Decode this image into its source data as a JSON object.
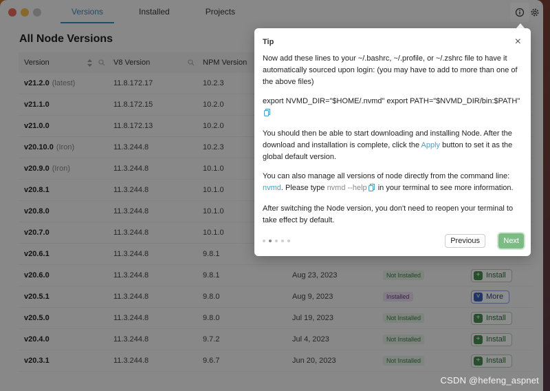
{
  "tabs": [
    "Versions",
    "Installed",
    "Projects"
  ],
  "heading": "All Node Versions",
  "columns": {
    "version": "Version",
    "v8": "V8 Version",
    "npm": "NPM Version"
  },
  "rows": [
    {
      "version": "v21.2.0",
      "tag": "(latest)",
      "v8": "11.8.172.17",
      "npm": "10.2.3",
      "date": "",
      "status": "",
      "action": ""
    },
    {
      "version": "v21.1.0",
      "tag": "",
      "v8": "11.8.172.15",
      "npm": "10.2.0",
      "date": "",
      "status": "",
      "action": ""
    },
    {
      "version": "v21.0.0",
      "tag": "",
      "v8": "11.8.172.13",
      "npm": "10.2.0",
      "date": "",
      "status": "",
      "action": ""
    },
    {
      "version": "v20.10.0",
      "tag": "(Iron)",
      "v8": "11.3.244.8",
      "npm": "10.2.3",
      "date": "",
      "status": "",
      "action": ""
    },
    {
      "version": "v20.9.0",
      "tag": "(Iron)",
      "v8": "11.3.244.8",
      "npm": "10.1.0",
      "date": "",
      "status": "",
      "action": ""
    },
    {
      "version": "v20.8.1",
      "tag": "",
      "v8": "11.3.244.8",
      "npm": "10.1.0",
      "date": "",
      "status": "",
      "action": ""
    },
    {
      "version": "v20.8.0",
      "tag": "",
      "v8": "11.3.244.8",
      "npm": "10.1.0",
      "date": "",
      "status": "",
      "action": ""
    },
    {
      "version": "v20.7.0",
      "tag": "",
      "v8": "11.3.244.8",
      "npm": "10.1.0",
      "date": "",
      "status": "",
      "action": ""
    },
    {
      "version": "v20.6.1",
      "tag": "",
      "v8": "11.3.244.8",
      "npm": "9.8.1",
      "date": "",
      "status": "",
      "action": ""
    },
    {
      "version": "v20.6.0",
      "tag": "",
      "v8": "11.3.244.8",
      "npm": "9.8.1",
      "date": "Aug 23, 2023",
      "status": "Not Installed",
      "action": "Install"
    },
    {
      "version": "v20.5.1",
      "tag": "",
      "v8": "11.3.244.8",
      "npm": "9.8.0",
      "date": "Aug 9, 2023",
      "status": "Installed",
      "action": "More"
    },
    {
      "version": "v20.5.0",
      "tag": "",
      "v8": "11.3.244.8",
      "npm": "9.8.0",
      "date": "Jul 19, 2023",
      "status": "Not Installed",
      "action": "Install"
    },
    {
      "version": "v20.4.0",
      "tag": "",
      "v8": "11.3.244.8",
      "npm": "9.7.2",
      "date": "Jul 4, 2023",
      "status": "Not Installed",
      "action": "Install"
    },
    {
      "version": "v20.3.1",
      "tag": "",
      "v8": "11.3.244.8",
      "npm": "9.6.7",
      "date": "Jun 20, 2023",
      "status": "Not Installed",
      "action": "Install"
    }
  ],
  "tip": {
    "title": "Tip",
    "p1": "Now add these lines to your ~/.bashrc, ~/.profile, or ~/.zshrc file to have it automatically sourced upon login: (you may have to add to more than one of the above files)",
    "code": "export NVMD_DIR=\"$HOME/.nvmd\" export PATH=\"$NVMD_DIR/bin:$PATH\"",
    "p2_pre": "You should then be able to start downloading and installing Node. After the download and installation is complete, click the ",
    "p2_apply": "Apply",
    "p2_post": " button to set it as the global default version.",
    "p3_pre": "You can also manage all versions of node directly from the command line: ",
    "p3_link": "nvmd",
    "p3_mid": ". Please type ",
    "p3_cmd": "nvmd --help",
    "p3_post": " in your terminal to see more information.",
    "p4": "After switching the Node version, you don't need to reopen your terminal to take effect by default.",
    "prev_label": "Previous",
    "next_label": "Next",
    "step_count": 5,
    "active_step": 2
  },
  "watermark": "CSDN @hefeng_aspnet",
  "colors": {
    "accent": "#3b8fb2",
    "install_green": "#4a8f55",
    "more_blue": "#3d62b8",
    "next_button": "#7dbb85"
  }
}
